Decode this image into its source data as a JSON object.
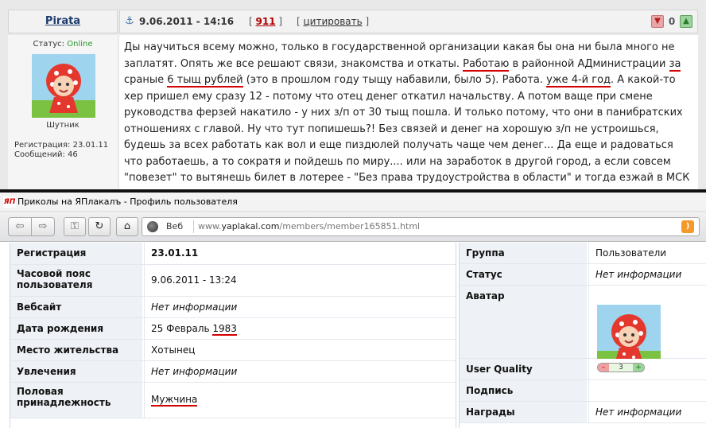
{
  "post": {
    "author": "Pirata",
    "date": "9.06.2011 - 14:16",
    "post_number": "911",
    "quote_label": "цитировать",
    "rating": "0",
    "status_label": "Статус:",
    "status_value": "Online",
    "nickname": "Шутник",
    "registration": "Регистрация: 23.01.11",
    "messages": "Сообщений: 46",
    "body": [
      [
        "Ды научиться всему можно, только в государственной организации какая бы она ни была много не"
      ],
      [
        "заплатят. Опять же все решают связи, знакомства и откаты. ",
        {
          "u": "Работаю"
        },
        " в районной АДминистрации ",
        {
          "u": "за"
        }
      ],
      [
        "сраные ",
        {
          "u": "6 тыщ рублей"
        },
        " (это в прошлом году тыщу набавили, было 5). Работа. ",
        {
          "u": "уже 4-й год"
        },
        ". А какой-то"
      ],
      [
        "хер пришел ему сразу 12 - потому что отец денег откатил начальству. А потом ваще при смене"
      ],
      [
        "руководства ферзей накатило - у них з/п от 30 тыщ пошла. И только потому, что они в панибратских"
      ],
      [
        "отношениях с главой. Ну что тут попишешь?! Без связей и денег на хорошую з/п не устроишься,"
      ],
      [
        "будешь за всех работать как вол и еще пиздюлей получать чаще чем денег... Да еще и радоваться"
      ],
      [
        "что работаешь, а то сократя и пойдешь по миру.... или на заработок в другой город, а если совсем"
      ],
      [
        "\"повезет\" то вытянешь билет в лотерее - \"Без права трудоустройства в области\" и тогда езжай в МСК"
      ]
    ]
  },
  "browser": {
    "title": "Приколы на ЯПлакалъ - Профиль пользователя",
    "favicon": "ЯП",
    "address_mode": "Веб",
    "url_prefix": "www.",
    "url_host": "yaplakal.com",
    "url_path": "/members/member165851.html"
  },
  "profile_left": [
    {
      "label": "Регистрация",
      "value": "23.01.11",
      "style": "bold"
    },
    {
      "label": "Часовой пояс пользователя",
      "value": "9.06.2011 - 13:24",
      "style": ""
    },
    {
      "label": "Вебсайт",
      "value": "Нет информации",
      "style": "italic"
    },
    {
      "label": "Дата рождения",
      "value": "25 Февраль ",
      "value_underlined": "1983",
      "style": ""
    },
    {
      "label": "Место жительства",
      "value": "Хотынец",
      "style": ""
    },
    {
      "label": "Увлечения",
      "value": "Нет информации",
      "style": "italic"
    },
    {
      "label": "Половая принадлежность",
      "value": "Мужчина",
      "style": "underlined"
    }
  ],
  "profile_right": [
    {
      "label": "Группа",
      "value": "Пользователи",
      "style": ""
    },
    {
      "label": "Статус",
      "value": "Нет информации",
      "style": "italic"
    },
    {
      "label": "Аватар",
      "value": "",
      "style": "avatar"
    },
    {
      "label": "User Quality",
      "value": "3",
      "minus": "–",
      "plus": "+",
      "style": "quality"
    },
    {
      "label": "Подпись",
      "value": "",
      "style": ""
    },
    {
      "label": "Награды",
      "value": "Нет информации",
      "style": "italic"
    }
  ],
  "colors": {
    "underline": "#d40000",
    "online": "#2e9a2e",
    "link": "#1e3c6e",
    "postnum": "#b00000"
  }
}
